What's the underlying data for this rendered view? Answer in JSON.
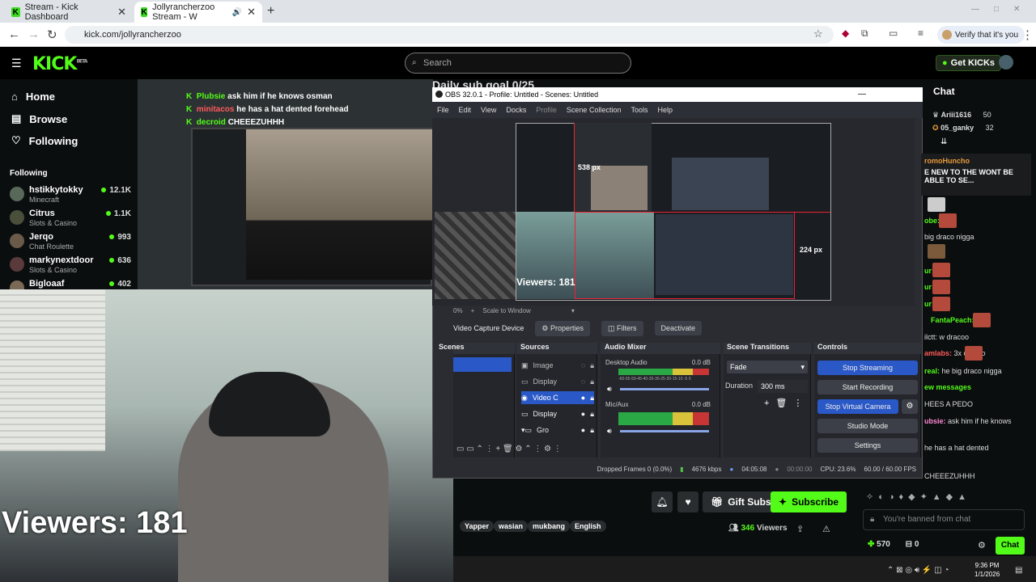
{
  "browser": {
    "tabs": [
      {
        "title": "Stream - Kick Dashboard"
      },
      {
        "title": "Jollyrancherzoo Stream - W"
      }
    ],
    "url": "kick.com/jollyrancherzoo",
    "verify_chip": "Verify that it's you"
  },
  "kick": {
    "logo": "KICK",
    "logo_badge": "BETA",
    "search_placeholder": "Search",
    "get_kicks": "Get KICKs",
    "nav": [
      {
        "label": "Home",
        "icon": "home-icon"
      },
      {
        "label": "Browse",
        "icon": "browse-icon"
      },
      {
        "label": "Following",
        "icon": "heart-icon"
      }
    ],
    "following_header": "Following",
    "following": [
      {
        "name": "hstikkytokky",
        "category": "Minecraft",
        "viewers": "12.1K"
      },
      {
        "name": "Citrus",
        "category": "Slots & Casino",
        "viewers": "1.1K"
      },
      {
        "name": "Jerqo",
        "category": "Chat Roulette",
        "viewers": "993"
      },
      {
        "name": "markynextdoor",
        "category": "Slots & Casino",
        "viewers": "636"
      },
      {
        "name": "Bigloaaf",
        "category": "",
        "viewers": "402"
      }
    ],
    "stream_overlay_chat": [
      {
        "user": "Plubsie",
        "text": "ask him if he knows osman"
      },
      {
        "user": "minitacos",
        "text": "he has a hat dented forehead"
      },
      {
        "user": "decroid",
        "text": "CHEEEZUHHH"
      }
    ],
    "sub_goal": "Daily sub goal 0/25",
    "webcam_viewers": "Viewers: 181",
    "gift_subs": "Gift Subs",
    "subscribe": "Subscribe",
    "tags": [
      "Yapper",
      "wasian",
      "mukbang",
      "English"
    ],
    "viewer_count": "346",
    "viewers_label": "Viewers"
  },
  "obs": {
    "title": "OBS 32.0.1 - Profile: Untitled - Scenes: Untitled",
    "menu": [
      "File",
      "Edit",
      "View",
      "Docks",
      "Profile",
      "Scene Collection",
      "Tools",
      "Help"
    ],
    "preview_px_top": "538 px",
    "preview_px_right": "224 px",
    "preview_viewers": "Viewers: 181",
    "zoom": "0%",
    "scale_label": "Scale to Window",
    "selected_source": "Video Capture Device",
    "properties": "Properties",
    "filters": "Filters",
    "deactivate": "Deactivate",
    "docks": {
      "scenes": "Scenes",
      "sources": "Sources",
      "audio_mixer": "Audio Mixer",
      "scene_transitions": "Scene Transitions",
      "controls": "Controls"
    },
    "sources": [
      "Image",
      "Display",
      "Video C",
      "Display",
      "Gro"
    ],
    "audio": [
      {
        "name": "Desktop Audio",
        "db": "0.0 dB"
      },
      {
        "name": "Mic/Aux",
        "db": "0.0 dB"
      }
    ],
    "meter_scale": "-60-55-50-45-40-35-30-25-20-15-10 -5 0",
    "transition": "Fade",
    "duration_label": "Duration",
    "duration": "300 ms",
    "controls": [
      "Stop Streaming",
      "Start Recording",
      "Stop Virtual Camera",
      "Studio Mode",
      "Settings"
    ],
    "status": {
      "dropped": "Dropped Frames 0 (0.0%)",
      "bitrate": "4676 kbps",
      "live_time": "04:05:08",
      "rec_time": "00:00:00",
      "cpu": "CPU: 23.6%",
      "fps": "60.00 / 60.00 FPS"
    }
  },
  "chat": {
    "title": "Chat",
    "leaderboard": [
      {
        "user": "Ariii1616",
        "count": "50"
      },
      {
        "user": "05_ganky",
        "count": "32"
      }
    ],
    "pinned_user": "romoHuncho",
    "pinned_text": "E NEW TO THE WONT BE ABLE TO SE...",
    "messages": [
      {
        "user": "obe:",
        "text": ""
      },
      {
        "user": "",
        "text": "big draco nigga"
      },
      {
        "user": "ur:",
        "text": ""
      },
      {
        "user": "ur:",
        "text": ""
      },
      {
        "user": "ur:",
        "text": ""
      },
      {
        "user": "FantaPeach:",
        "text": ""
      },
      {
        "user": "",
        "text": "ilctt: w dracoo"
      },
      {
        "user": "amlabs:",
        "text": "3x combo"
      },
      {
        "user": "real:",
        "text": "he big draco nigga"
      },
      {
        "user": "",
        "text": "ew messages"
      },
      {
        "user": "",
        "text": "HEES A PEDO"
      },
      {
        "user": "ubsie:",
        "text": "ask him if he knows"
      },
      {
        "user": "",
        "text": "he has a hat dented"
      },
      {
        "user": "",
        "text": "CHEEEZUHHH"
      }
    ],
    "banned": "You're banned from chat",
    "kicks": "570",
    "zero": "0",
    "chat_button": "Chat"
  },
  "taskbar": {
    "time": "9:36 PM",
    "date": "1/1/2026"
  }
}
